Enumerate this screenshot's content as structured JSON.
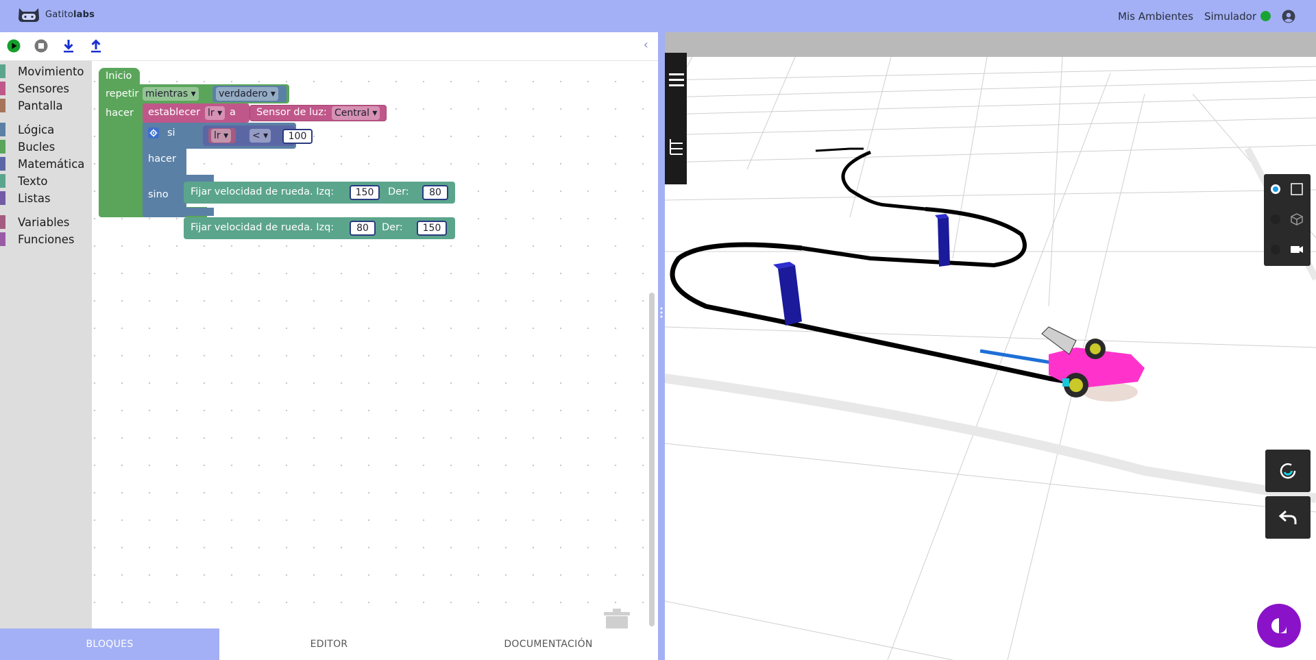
{
  "app": {
    "brand_first": "Gatito",
    "brand_second": "labs"
  },
  "topnav": {
    "ambientes": "Mis Ambientes",
    "simulador": "Simulador",
    "status_color": "#1aa334"
  },
  "toolbar": {
    "icons": [
      "play-icon",
      "stop-icon",
      "download-icon",
      "upload-icon"
    ],
    "collapse_glyph": "‹"
  },
  "toolbox": {
    "categories": [
      {
        "label": "Movimiento",
        "color": "#5ba58c"
      },
      {
        "label": "Sensores",
        "color": "#c0578a"
      },
      {
        "label": "Pantalla",
        "color": "#a5745b"
      },
      {
        "label": "Lógica",
        "color": "#5b80a5"
      },
      {
        "label": "Bucles",
        "color": "#5ba55b"
      },
      {
        "label": "Matemática",
        "color": "#5b67a5"
      },
      {
        "label": "Texto",
        "color": "#5ba58c"
      },
      {
        "label": "Listas",
        "color": "#745ba5"
      },
      {
        "label": "Variables",
        "color": "#a55b80"
      },
      {
        "label": "Funciones",
        "color": "#995ba5"
      }
    ]
  },
  "blocks": {
    "inicio": "Inicio",
    "repetir": "repetir",
    "mientras": "mientras ▾",
    "verdadero": "verdadero ▾",
    "hacer1": "hacer",
    "establecer": "establecer",
    "var_lr": "lr ▾",
    "a": "a",
    "sensor_luz": "Sensor de luz:",
    "central": "Central ▾",
    "si": "si",
    "lr_cmp": "lr ▾",
    "op": "< ▾",
    "threshold": "100",
    "hacer2": "hacer",
    "sino": "sino",
    "fijar1": "Fijar velocidad de rueda. Izq:",
    "izq1": "150",
    "der_label1": "Der:",
    "der1": "80",
    "fijar2": "Fijar velocidad de rueda. Izq:",
    "izq2": "80",
    "der_label2": "Der:",
    "der2": "150"
  },
  "tabs": [
    {
      "label": "BLOQUES",
      "active": true
    },
    {
      "label": "EDITOR",
      "active": false
    },
    {
      "label": "DOCUMENTACIÓN",
      "active": false
    }
  ],
  "colors": {
    "accent": "#a3b0f5",
    "loop_green": "#5ba55b",
    "sensor_pink": "#c0578a",
    "logic_blue": "#5b80a5",
    "move_teal": "#5ba58c",
    "chat_purple": "#8a12c9"
  }
}
